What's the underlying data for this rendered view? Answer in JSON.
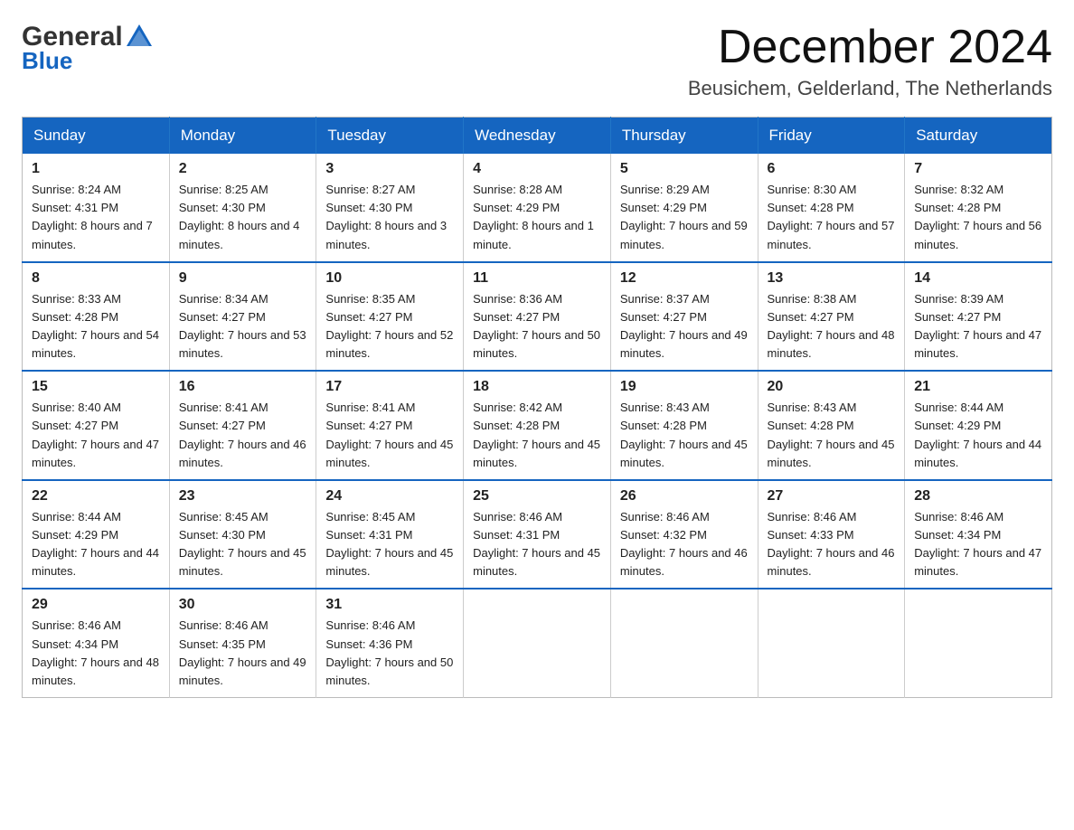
{
  "logo": {
    "general": "General",
    "blue": "Blue"
  },
  "header": {
    "month": "December 2024",
    "location": "Beusichem, Gelderland, The Netherlands"
  },
  "weekdays": [
    "Sunday",
    "Monday",
    "Tuesday",
    "Wednesday",
    "Thursday",
    "Friday",
    "Saturday"
  ],
  "weeks": [
    [
      {
        "day": "1",
        "sunrise": "8:24 AM",
        "sunset": "4:31 PM",
        "daylight": "8 hours and 7 minutes."
      },
      {
        "day": "2",
        "sunrise": "8:25 AM",
        "sunset": "4:30 PM",
        "daylight": "8 hours and 4 minutes."
      },
      {
        "day": "3",
        "sunrise": "8:27 AM",
        "sunset": "4:30 PM",
        "daylight": "8 hours and 3 minutes."
      },
      {
        "day": "4",
        "sunrise": "8:28 AM",
        "sunset": "4:29 PM",
        "daylight": "8 hours and 1 minute."
      },
      {
        "day": "5",
        "sunrise": "8:29 AM",
        "sunset": "4:29 PM",
        "daylight": "7 hours and 59 minutes."
      },
      {
        "day": "6",
        "sunrise": "8:30 AM",
        "sunset": "4:28 PM",
        "daylight": "7 hours and 57 minutes."
      },
      {
        "day": "7",
        "sunrise": "8:32 AM",
        "sunset": "4:28 PM",
        "daylight": "7 hours and 56 minutes."
      }
    ],
    [
      {
        "day": "8",
        "sunrise": "8:33 AM",
        "sunset": "4:28 PM",
        "daylight": "7 hours and 54 minutes."
      },
      {
        "day": "9",
        "sunrise": "8:34 AM",
        "sunset": "4:27 PM",
        "daylight": "7 hours and 53 minutes."
      },
      {
        "day": "10",
        "sunrise": "8:35 AM",
        "sunset": "4:27 PM",
        "daylight": "7 hours and 52 minutes."
      },
      {
        "day": "11",
        "sunrise": "8:36 AM",
        "sunset": "4:27 PM",
        "daylight": "7 hours and 50 minutes."
      },
      {
        "day": "12",
        "sunrise": "8:37 AM",
        "sunset": "4:27 PM",
        "daylight": "7 hours and 49 minutes."
      },
      {
        "day": "13",
        "sunrise": "8:38 AM",
        "sunset": "4:27 PM",
        "daylight": "7 hours and 48 minutes."
      },
      {
        "day": "14",
        "sunrise": "8:39 AM",
        "sunset": "4:27 PM",
        "daylight": "7 hours and 47 minutes."
      }
    ],
    [
      {
        "day": "15",
        "sunrise": "8:40 AM",
        "sunset": "4:27 PM",
        "daylight": "7 hours and 47 minutes."
      },
      {
        "day": "16",
        "sunrise": "8:41 AM",
        "sunset": "4:27 PM",
        "daylight": "7 hours and 46 minutes."
      },
      {
        "day": "17",
        "sunrise": "8:41 AM",
        "sunset": "4:27 PM",
        "daylight": "7 hours and 45 minutes."
      },
      {
        "day": "18",
        "sunrise": "8:42 AM",
        "sunset": "4:28 PM",
        "daylight": "7 hours and 45 minutes."
      },
      {
        "day": "19",
        "sunrise": "8:43 AM",
        "sunset": "4:28 PM",
        "daylight": "7 hours and 45 minutes."
      },
      {
        "day": "20",
        "sunrise": "8:43 AM",
        "sunset": "4:28 PM",
        "daylight": "7 hours and 45 minutes."
      },
      {
        "day": "21",
        "sunrise": "8:44 AM",
        "sunset": "4:29 PM",
        "daylight": "7 hours and 44 minutes."
      }
    ],
    [
      {
        "day": "22",
        "sunrise": "8:44 AM",
        "sunset": "4:29 PM",
        "daylight": "7 hours and 44 minutes."
      },
      {
        "day": "23",
        "sunrise": "8:45 AM",
        "sunset": "4:30 PM",
        "daylight": "7 hours and 45 minutes."
      },
      {
        "day": "24",
        "sunrise": "8:45 AM",
        "sunset": "4:31 PM",
        "daylight": "7 hours and 45 minutes."
      },
      {
        "day": "25",
        "sunrise": "8:46 AM",
        "sunset": "4:31 PM",
        "daylight": "7 hours and 45 minutes."
      },
      {
        "day": "26",
        "sunrise": "8:46 AM",
        "sunset": "4:32 PM",
        "daylight": "7 hours and 46 minutes."
      },
      {
        "day": "27",
        "sunrise": "8:46 AM",
        "sunset": "4:33 PM",
        "daylight": "7 hours and 46 minutes."
      },
      {
        "day": "28",
        "sunrise": "8:46 AM",
        "sunset": "4:34 PM",
        "daylight": "7 hours and 47 minutes."
      }
    ],
    [
      {
        "day": "29",
        "sunrise": "8:46 AM",
        "sunset": "4:34 PM",
        "daylight": "7 hours and 48 minutes."
      },
      {
        "day": "30",
        "sunrise": "8:46 AM",
        "sunset": "4:35 PM",
        "daylight": "7 hours and 49 minutes."
      },
      {
        "day": "31",
        "sunrise": "8:46 AM",
        "sunset": "4:36 PM",
        "daylight": "7 hours and 50 minutes."
      },
      null,
      null,
      null,
      null
    ]
  ]
}
